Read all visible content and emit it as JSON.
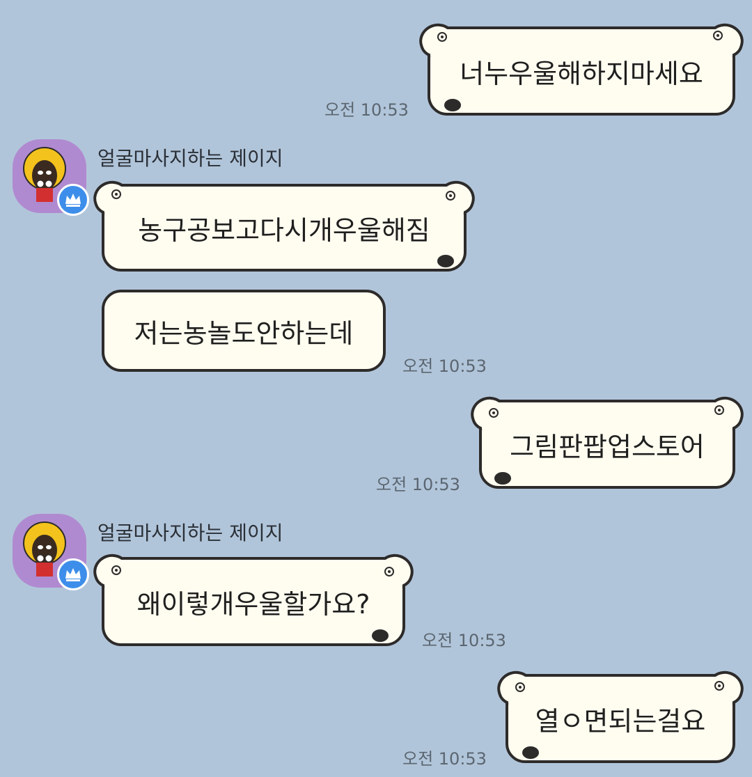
{
  "messages": [
    {
      "sender": "me",
      "text": "너누우울해하지마세요",
      "time": "오전 10:53"
    },
    {
      "sender": "other",
      "name": "얼굴마사지하는 제이지",
      "text": "농구공보고다시개우울해짐"
    },
    {
      "sender": "other",
      "text": "저는농놀도안하는데",
      "time": "오전 10:53"
    },
    {
      "sender": "me",
      "text": "그림판팝업스토어",
      "time": "오전 10:53"
    },
    {
      "sender": "other",
      "name": "얼굴마사지하는 제이지",
      "text": "왜이렇개우울할가요?",
      "time": "오전 10:53"
    },
    {
      "sender": "me",
      "text": "열ㅇ면되는걸요",
      "time": "오전 10:53"
    }
  ],
  "colors": {
    "background": "#b1c5da",
    "bubble_fill": "#fffdf0",
    "bubble_border": "#2d2b2a",
    "avatar_bg": "#b08ad0",
    "badge": "#3d8eea"
  },
  "icons": {
    "avatar": "afro-character-avatar",
    "badge": "crown-icon"
  }
}
